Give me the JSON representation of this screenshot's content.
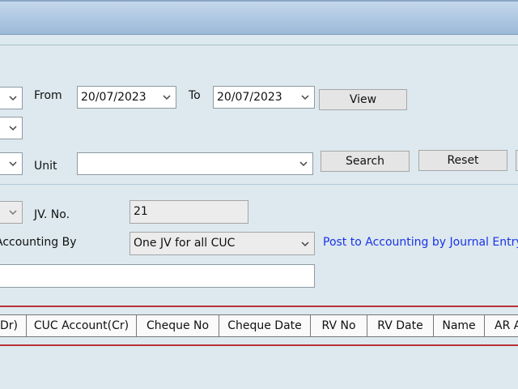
{
  "filters": {
    "from_label": "From",
    "from_date": "20/07/2023",
    "to_label": "To",
    "to_date": "20/07/2023",
    "view_button": "View",
    "unit_label": "Unit",
    "unit_value": "",
    "search_button": "Search",
    "reset_button": "Reset"
  },
  "journal": {
    "jv_label": "JV. No.",
    "jv_value": "21",
    "accounting_by_label": "Accounting By",
    "accounting_by_value": "One JV for all CUC",
    "post_link": "Post to Accounting by Journal Entry",
    "remarks_value": ""
  },
  "grid": {
    "columns": [
      "Dr)",
      "CUC Account(Cr)",
      "Cheque No",
      "Cheque Date",
      "RV No",
      "RV Date",
      "Name",
      "AR A"
    ]
  }
}
